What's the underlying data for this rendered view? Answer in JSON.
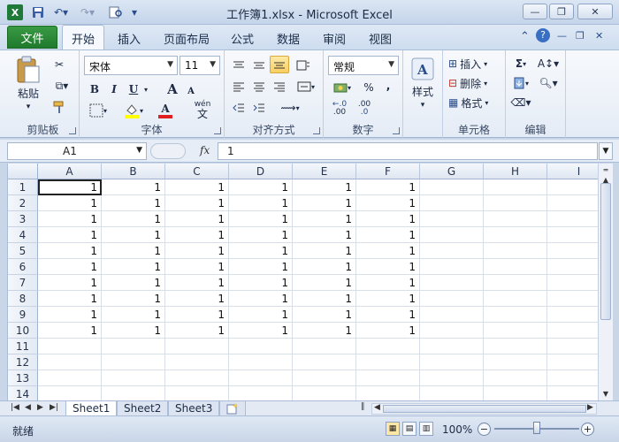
{
  "window": {
    "title": "工作簿1.xlsx  -  Microsoft Excel",
    "app_icon": "X",
    "minimize": "—",
    "restore": "❐",
    "close": "✕"
  },
  "tabs": {
    "file": "文件",
    "items": [
      "开始",
      "插入",
      "页面布局",
      "公式",
      "数据",
      "审阅",
      "视图"
    ],
    "active": "开始"
  },
  "ribbon": {
    "clipboard": {
      "label": "剪贴板",
      "paste": "粘贴"
    },
    "font": {
      "label": "字体",
      "family": "宋体",
      "size": "11",
      "bold": "B",
      "italic": "I",
      "underline": "U",
      "grow": "A",
      "shrink": "A",
      "font_color": "A",
      "pinyin": "wén"
    },
    "alignment": {
      "label": "对齐方式"
    },
    "number": {
      "label": "数字",
      "format": "常规",
      "percent": "%",
      "comma": ",",
      "inc_decimal": ".00",
      "dec_decimal": ".0"
    },
    "styles": {
      "label": "样式"
    },
    "cells": {
      "label": "单元格",
      "insert": "插入",
      "delete": "删除",
      "format": "格式"
    },
    "editing": {
      "label": "编辑",
      "sum": "Σ"
    }
  },
  "formula_bar": {
    "name_box": "A1",
    "fx": "fx",
    "content": "1"
  },
  "grid": {
    "columns": [
      "A",
      "B",
      "C",
      "D",
      "E",
      "F",
      "G",
      "H",
      "I"
    ],
    "rows": [
      "1",
      "2",
      "3",
      "4",
      "5",
      "6",
      "7",
      "8",
      "9",
      "10",
      "11",
      "12",
      "13",
      "14"
    ],
    "data": [
      [
        "1",
        "1",
        "1",
        "1",
        "1",
        "1"
      ],
      [
        "1",
        "1",
        "1",
        "1",
        "1",
        "1"
      ],
      [
        "1",
        "1",
        "1",
        "1",
        "1",
        "1"
      ],
      [
        "1",
        "1",
        "1",
        "1",
        "1",
        "1"
      ],
      [
        "1",
        "1",
        "1",
        "1",
        "1",
        "1"
      ],
      [
        "1",
        "1",
        "1",
        "1",
        "1",
        "1"
      ],
      [
        "1",
        "1",
        "1",
        "1",
        "1",
        "1"
      ],
      [
        "1",
        "1",
        "1",
        "1",
        "1",
        "1"
      ],
      [
        "1",
        "1",
        "1",
        "1",
        "1",
        "1"
      ],
      [
        "1",
        "1",
        "1",
        "1",
        "1",
        "1"
      ]
    ],
    "selected_cell": "A1"
  },
  "sheets": {
    "tabs": [
      "Sheet1",
      "Sheet2",
      "Sheet3"
    ],
    "active": "Sheet1"
  },
  "status": {
    "text": "就绪",
    "zoom": "100%",
    "zoom_fraction": 0.5
  }
}
